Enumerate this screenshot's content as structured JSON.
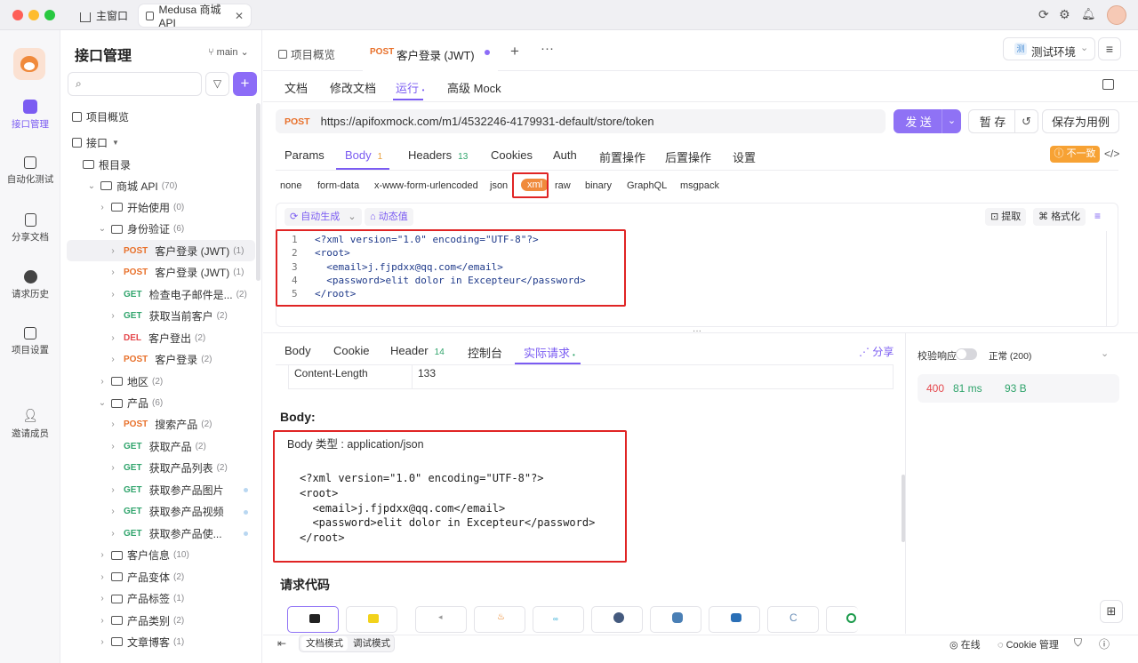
{
  "titlebar": {
    "tabs": [
      {
        "label": "主窗口"
      },
      {
        "label": "Medusa 商城 API"
      }
    ]
  },
  "rail": {
    "items": [
      {
        "label": "接口管理",
        "icon": "api-icon"
      },
      {
        "label": "自动化测试",
        "icon": "automation-icon"
      },
      {
        "label": "分享文档",
        "icon": "share-doc-icon"
      },
      {
        "label": "请求历史",
        "icon": "history-icon"
      },
      {
        "label": "项目设置",
        "icon": "settings-icon"
      },
      {
        "label": "邀请成员",
        "icon": "invite-icon"
      }
    ]
  },
  "sidebar": {
    "title": "接口管理",
    "branch": "main",
    "overview": "项目概览",
    "interfaces": "接口",
    "root": "根目录",
    "tree": [
      {
        "type": "folder",
        "label": "商城 API",
        "count": "(70)",
        "open": true,
        "indent": 1
      },
      {
        "type": "folder",
        "label": "开始使用",
        "count": "(0)",
        "open": false,
        "indent": 2
      },
      {
        "type": "folder",
        "label": "身份验证",
        "count": "(6)",
        "open": true,
        "indent": 2
      },
      {
        "type": "api",
        "method": "POST",
        "label": "客户登录 (JWT)",
        "count": "(1)",
        "indent": 3,
        "selected": true
      },
      {
        "type": "api",
        "method": "POST",
        "label": "客户登录 (JWT)",
        "count": "(1)",
        "indent": 3
      },
      {
        "type": "api",
        "method": "GET",
        "label": "检查电子邮件是...",
        "count": "(2)",
        "indent": 3
      },
      {
        "type": "api",
        "method": "GET",
        "label": "获取当前客户",
        "count": "(2)",
        "indent": 3
      },
      {
        "type": "api",
        "method": "DEL",
        "label": "客户登出",
        "count": "(2)",
        "indent": 3
      },
      {
        "type": "api",
        "method": "POST",
        "label": "客户登录",
        "count": "(2)",
        "indent": 3
      },
      {
        "type": "folder",
        "label": "地区",
        "count": "(2)",
        "open": false,
        "indent": 2
      },
      {
        "type": "folder",
        "label": "产品",
        "count": "(6)",
        "open": true,
        "indent": 2
      },
      {
        "type": "api",
        "method": "POST",
        "label": "搜索产品",
        "count": "(2)",
        "indent": 3
      },
      {
        "type": "api",
        "method": "GET",
        "label": "获取产品",
        "count": "(2)",
        "indent": 3
      },
      {
        "type": "api",
        "method": "GET",
        "label": "获取产品列表",
        "count": "(2)",
        "indent": 3
      },
      {
        "type": "api",
        "method": "GET",
        "label": "获取参产品图片",
        "count": "",
        "indent": 3,
        "dot": true
      },
      {
        "type": "api",
        "method": "GET",
        "label": "获取参产品视频",
        "count": "",
        "indent": 3,
        "dot": true
      },
      {
        "type": "api",
        "method": "GET",
        "label": "获取参产品使...",
        "count": "",
        "indent": 3,
        "dot": true
      },
      {
        "type": "folder",
        "label": "客户信息",
        "count": "(10)",
        "open": false,
        "indent": 2
      },
      {
        "type": "folder",
        "label": "产品变体",
        "count": "(2)",
        "open": false,
        "indent": 2
      },
      {
        "type": "folder",
        "label": "产品标签",
        "count": "(1)",
        "open": false,
        "indent": 2
      },
      {
        "type": "folder",
        "label": "产品类别",
        "count": "(2)",
        "open": false,
        "indent": 2
      },
      {
        "type": "folder",
        "label": "文章博客",
        "count": "(1)",
        "open": false,
        "indent": 2
      }
    ]
  },
  "doc_tabs": {
    "overview": "项目概览",
    "active_method": "POST",
    "active_label": "客户登录 (JWT)",
    "env": "测试环境",
    "env_badge": "测"
  },
  "subtabs": [
    "文档",
    "修改文档",
    "运行",
    "高级 Mock"
  ],
  "request": {
    "method": "POST",
    "url": "https://apifoxmock.com/m1/4532246-4179931-default/store/token",
    "send": "发 送",
    "save_draft": "暂 存",
    "save_case": "保存为用例"
  },
  "param_tabs": [
    {
      "label": "Params",
      "badge": ""
    },
    {
      "label": "Body",
      "badge": "1"
    },
    {
      "label": "Headers",
      "badge": "13"
    },
    {
      "label": "Cookies",
      "badge": ""
    },
    {
      "label": "Auth",
      "badge": ""
    },
    {
      "label": "前置操作",
      "badge": ""
    },
    {
      "label": "后置操作",
      "badge": ""
    },
    {
      "label": "设置",
      "badge": ""
    }
  ],
  "mismatch": "不一致",
  "content_types": [
    "none",
    "form-data",
    "x-www-form-urlencoded",
    "json",
    "xml",
    "raw",
    "binary",
    "GraphQL",
    "msgpack"
  ],
  "editor": {
    "auto_gen": "自动生成",
    "dynamic": "动态值",
    "extract": "提取",
    "format": "格式化",
    "lines": [
      "<?xml version=\"1.0\" encoding=\"UTF-8\"?>",
      "<root>",
      "  <email>j.fjpdxx@qq.com</email>",
      "  <password>elit dolor in Excepteur</password>",
      "</root>"
    ]
  },
  "response": {
    "tabs": [
      {
        "label": "Body",
        "badge": ""
      },
      {
        "label": "Cookie",
        "badge": ""
      },
      {
        "label": "Header",
        "badge": "14"
      },
      {
        "label": "控制台",
        "badge": ""
      },
      {
        "label": "实际请求",
        "badge": ""
      }
    ],
    "share": "分享",
    "content_length_key": "Content-Length",
    "content_length_val": "133",
    "body_heading": "Body:",
    "body_type": "Body 类型 : application/json",
    "body_lines": [
      "<?xml version=\"1.0\" encoding=\"UTF-8\"?>",
      "<root>",
      "  <email>j.fjpdxx@qq.com</email>",
      "  <password>elit dolor in Excepteur</password>",
      "</root>"
    ],
    "code_heading": "请求代码",
    "validate": "校验响应",
    "normal": "正常 (200)",
    "status": "400",
    "time": "81 ms",
    "size": "93 B"
  },
  "footer": {
    "doc_mode": "文档模式",
    "debug_mode": "调试模式",
    "online": "在线",
    "cookie": "Cookie 管理"
  },
  "colors": {
    "accent": "#7b5cf2",
    "post": "#e8702a",
    "get": "#30a46c",
    "del": "#e5484d",
    "highlight": "#e02424"
  }
}
